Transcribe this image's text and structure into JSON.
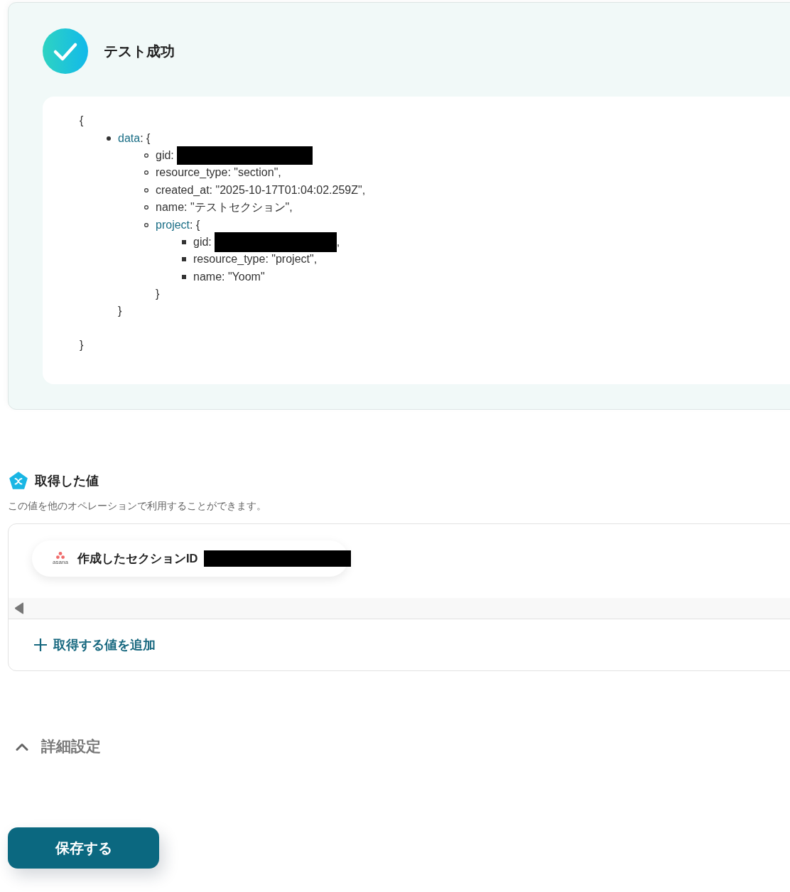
{
  "test_result": {
    "status_title": "テスト成功",
    "output": {
      "open": "{",
      "close": "}",
      "entries": [
        {
          "key": "data",
          "text": ": {",
          "close": "}",
          "children": [
            {
              "text": "gid: ",
              "redacted": true
            },
            {
              "text": "resource_type: \"section\","
            },
            {
              "text": "created_at: \"2025-10-17T01:04:02.259Z\","
            },
            {
              "text": "name: \"テストセクション\","
            },
            {
              "key": "project",
              "text": ": {",
              "close": "}",
              "children": [
                {
                  "text": "gid: ",
                  "redacted": true,
                  "after": ","
                },
                {
                  "text": "resource_type: \"project\","
                },
                {
                  "text": "name: \"Yoom\""
                }
              ]
            }
          ]
        }
      ]
    }
  },
  "retrieved_values": {
    "title": "取得した値",
    "description": "この値を他のオペレーションで利用することができます。",
    "values": [
      {
        "logo_text": "asana",
        "label": "作成したセクションID",
        "redacted": true
      }
    ],
    "add_button": "取得する値を追加"
  },
  "advanced_settings": {
    "label": "詳細設定",
    "expanded": true
  },
  "save_button": "保存する"
}
